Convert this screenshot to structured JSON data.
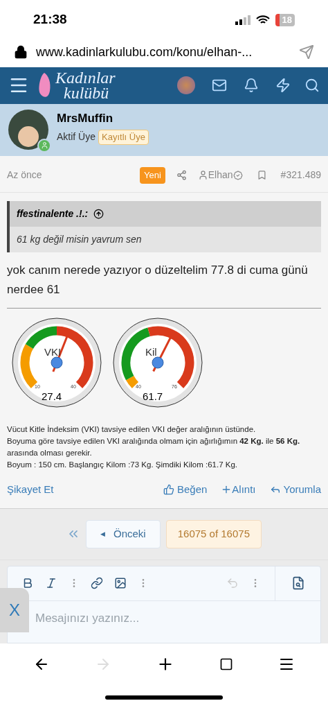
{
  "status_bar": {
    "time": "21:38",
    "battery": "18"
  },
  "url_bar": {
    "url": "www.kadinlarkulubu.com/konu/elhan-..."
  },
  "nav": {
    "logo_line1": "Kadınlar",
    "logo_line2": "kulübü"
  },
  "author": {
    "name": "MrsMuffin",
    "title": "Aktif Üye",
    "badge": "Kayıtlı Üye",
    "online": true
  },
  "post": {
    "time": "Az önce",
    "new_badge": "Yeni",
    "mention": "Elhan",
    "number": "#321.489",
    "quote": {
      "author": "ffestinalente .!.:",
      "text": "61 kg değil misin yavrum sen"
    },
    "text": "yok canım nerede yazıyor o düzeltelim 77.8 di cuma günü nerdee 61",
    "gauges": [
      {
        "label": "VKI",
        "min": "10",
        "max": "40",
        "value": "27.4"
      },
      {
        "label": "Kil",
        "min": "40",
        "max": "76",
        "value": "61.7"
      }
    ],
    "signature": [
      "Vücut Kitle İndeksim (VKI) tavsiye edilen VKI değer aralığının üstünde.",
      "Boyuma göre tavsiye edilen VKI aralığında olmam için ağırlığımın **42 Kg.** ile **56 Kg.** arasında olması gerekir.",
      "Boyum : 150 cm. Başlangıç Kilom :73 Kg. Şimdiki Kilom :61.7 Kg."
    ],
    "actions": {
      "report": "Şikayet Et",
      "like": "Beğen",
      "quote": "Alıntı",
      "reply": "Yorumla"
    }
  },
  "pagination": {
    "prev_icon": "◀",
    "prev": "Önceki",
    "current": "16075 of 16075"
  },
  "editor": {
    "placeholder": "Mesajınızı yazınız...",
    "close": "X"
  }
}
